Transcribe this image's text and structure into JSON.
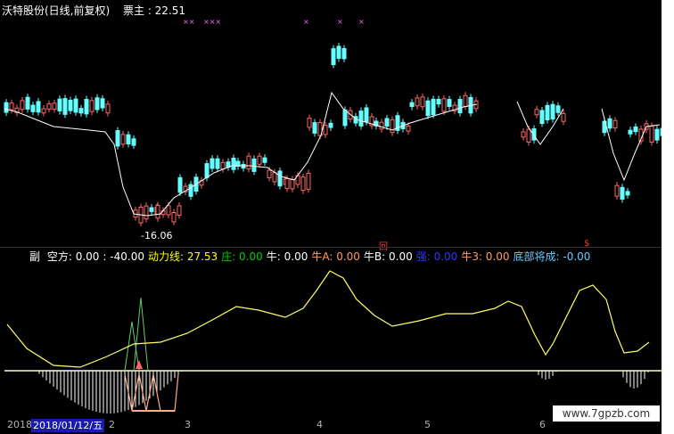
{
  "header": {
    "title": "沃特股份(日线,前复权)",
    "ticket_label": "票主 : 22.51"
  },
  "main": {
    "low_price_label": "-16.06",
    "marker_glyph": "回",
    "marker2_glyph": "$"
  },
  "indicator": {
    "prefix": "副",
    "items": [
      {
        "label": "空方: 0.00",
        "color": "#ffffff"
      },
      {
        "label": ": -40.00",
        "color": "#ffffff"
      },
      {
        "label": "动力线: 27.53",
        "color": "#ffff00"
      },
      {
        "label": "庄: 0.00",
        "color": "#00cc00"
      },
      {
        "label": "牛: 0.00",
        "color": "#ffffff"
      },
      {
        "label": "牛A: 0.00",
        "color": "#ff9966"
      },
      {
        "label": "牛B: 0.00",
        "color": "#ffffff"
      },
      {
        "label": "强: 0.00",
        "color": "#3333ff"
      },
      {
        "label": "牛3: 0.00",
        "color": "#ff9966"
      },
      {
        "label": "底部将成: -0.00",
        "color": "#66ccff"
      }
    ]
  },
  "axis": {
    "year": "2018",
    "selected_date": "2018/01/12/五",
    "ticks": [
      "2",
      "3",
      "4",
      "5",
      "6"
    ]
  },
  "watermark": "www.7gpzb.com",
  "colors": {
    "up": "#ff6666",
    "down": "#66ffff",
    "line": "#ffff66",
    "baseline": "#ffffff"
  }
}
